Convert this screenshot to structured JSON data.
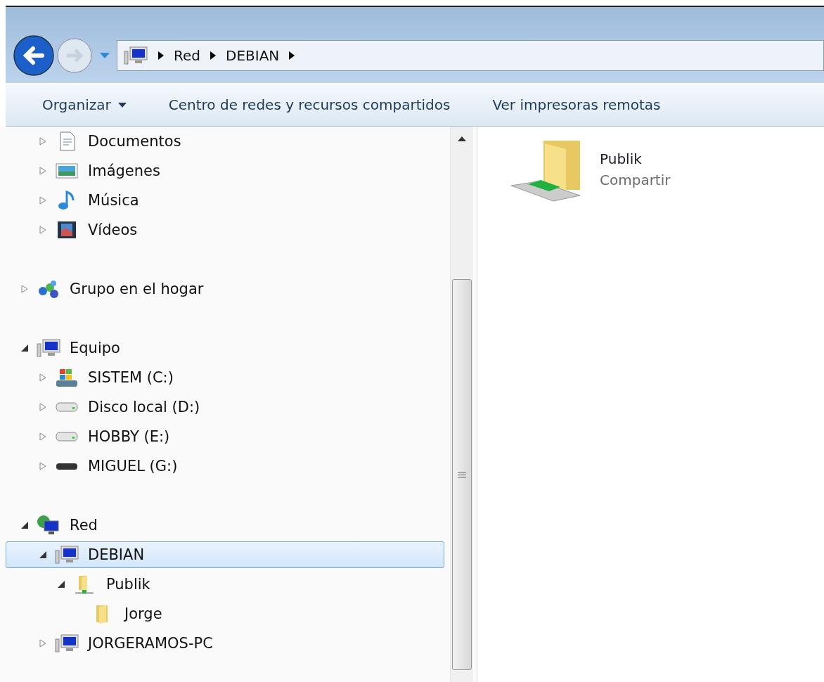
{
  "address_bar": {
    "crumbs": [
      "Red",
      "DEBIAN"
    ]
  },
  "toolbar": {
    "buttons": [
      {
        "label": "Organizar",
        "dropdown": true
      },
      {
        "label": "Centro de redes y recursos compartidos",
        "dropdown": false
      },
      {
        "label": "Ver impresoras remotas",
        "dropdown": false
      }
    ]
  },
  "navigation": {
    "sections": [
      {
        "continued": true,
        "items": [
          {
            "label": "Documentos",
            "kind": "document",
            "expanded": false,
            "selected": false
          },
          {
            "label": "Imágenes",
            "kind": "pictures",
            "expanded": false,
            "selected": false
          },
          {
            "label": "Música",
            "kind": "music",
            "expanded": false,
            "selected": false
          },
          {
            "label": "Vídeos",
            "kind": "videos",
            "expanded": false,
            "selected": false
          }
        ]
      },
      {
        "continued": false,
        "items": [
          {
            "label": "Grupo en el hogar",
            "kind": "homegroup",
            "expanded": false,
            "selected": false
          }
        ]
      },
      {
        "continued": false,
        "items": [
          {
            "label": "Equipo",
            "kind": "computer",
            "expanded": true,
            "selected": false,
            "children": [
              {
                "label": "SISTEM (C:)",
                "kind": "system-drive",
                "expanded": false,
                "selected": false
              },
              {
                "label": "Disco local (D:)",
                "kind": "drive",
                "expanded": false,
                "selected": false
              },
              {
                "label": "HOBBY (E:)",
                "kind": "drive",
                "expanded": false,
                "selected": false
              },
              {
                "label": "MIGUEL (G:)",
                "kind": "removable-drive",
                "expanded": false,
                "selected": false
              }
            ]
          }
        ]
      },
      {
        "continued": false,
        "items": [
          {
            "label": "Red",
            "kind": "network",
            "expanded": true,
            "selected": false,
            "children": [
              {
                "label": "DEBIAN",
                "kind": "computer",
                "expanded": true,
                "selected": true,
                "children": [
                  {
                    "label": "Publik",
                    "kind": "share",
                    "expanded": true,
                    "selected": false,
                    "children": [
                      {
                        "label": "Jorge",
                        "kind": "folder",
                        "selected": false
                      }
                    ]
                  }
                ]
              },
              {
                "label": "JORGERAMOS-PC",
                "kind": "computer",
                "expanded": false,
                "selected": false
              }
            ]
          }
        ]
      }
    ]
  },
  "content": {
    "items": [
      {
        "name": "Publik",
        "subtitle": "Compartir",
        "kind": "share"
      }
    ]
  }
}
